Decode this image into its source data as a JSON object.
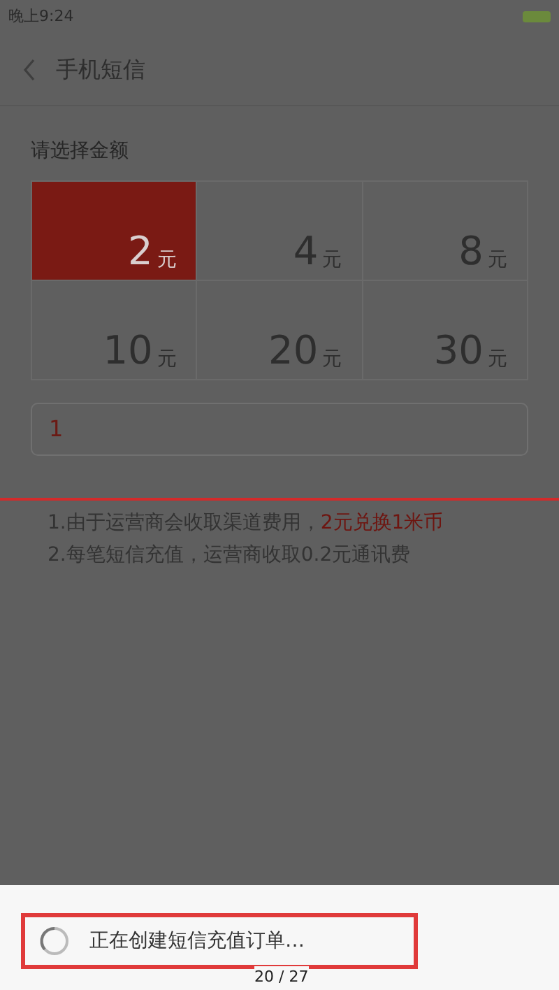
{
  "status_bar": {
    "time": "晚上9:24"
  },
  "header": {
    "title": "手机短信"
  },
  "amount_label": "请选择金额",
  "amounts": [
    {
      "value": "2",
      "unit": "元",
      "selected": true
    },
    {
      "value": "4",
      "unit": "元",
      "selected": false
    },
    {
      "value": "8",
      "unit": "元",
      "selected": false
    },
    {
      "value": "10",
      "unit": "元",
      "selected": false
    },
    {
      "value": "20",
      "unit": "元",
      "selected": false
    },
    {
      "value": "30",
      "unit": "元",
      "selected": false
    }
  ],
  "amount_field": {
    "value": "1"
  },
  "notes": [
    {
      "parts": [
        {
          "text": "1.由于运营商会收取渠道费用，",
          "highlighted": false
        },
        {
          "text": "2元兑换1米币",
          "highlighted": true
        }
      ]
    },
    {
      "parts": [
        {
          "text": "2.每笔短信充值，运营商收取0.2元通讯费",
          "highlighted": false
        }
      ]
    }
  ],
  "dialog": {
    "message": "正在创建短信充值订单…"
  },
  "page_counter": "20 / 27"
}
